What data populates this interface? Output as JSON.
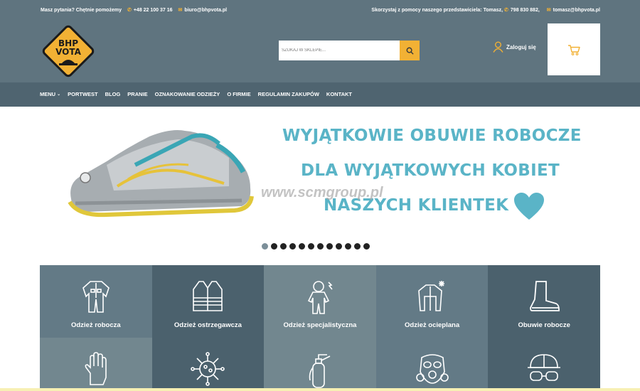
{
  "topbar": {
    "question": "Masz pytania? Chętnie pomożemy",
    "phone": "+48 22 100 37 16",
    "email": "biuro@bhpvota.pl",
    "rep_text": "Skorzystaj z pomocy naszego przedstawiciela: Tomasz,",
    "rep_phone": "798 830 882,",
    "rep_email": "tomasz@bhpvota.pl"
  },
  "logo": {
    "line1": "BHP",
    "line2": "VOTA"
  },
  "search": {
    "placeholder": "SZUKAJ W SKLEPIE..."
  },
  "account": {
    "login_label": "Zaloguj się"
  },
  "nav": {
    "items": [
      "MENU",
      "PORTWEST",
      "BLOG",
      "PRANIE",
      "OZNAKOWANIE ODZIEŻY",
      "O FIRMIE",
      "REGULAMIN ZAKUPÓW",
      "KONTAKT"
    ]
  },
  "hero": {
    "line1": "WYJĄTKOWIE OBUWIE ROBOCZE",
    "line2": "DLA WYJĄTKOWYCH KOBIET",
    "line3": "NASZYCH KLIENTEK",
    "watermark": "www.scmgroup.pl",
    "slide_count": 12,
    "active_slide": 1
  },
  "categories": [
    {
      "label": "Odzież robocza",
      "icon": "coverall-icon"
    },
    {
      "label": "Odzież ostrzegawcza",
      "icon": "hi-vis-vest-icon"
    },
    {
      "label": "Odzież specjalistyczna",
      "icon": "hazmat-suit-icon"
    },
    {
      "label": "Odzież ocieplana",
      "icon": "winter-coat-icon"
    },
    {
      "label": "Obuwie robocze",
      "icon": "work-boot-icon"
    },
    {
      "label": "",
      "icon": "glove-icon"
    },
    {
      "label": "",
      "icon": "virus-icon"
    },
    {
      "label": "",
      "icon": "fire-extinguisher-icon"
    },
    {
      "label": "",
      "icon": "gas-mask-icon"
    },
    {
      "label": "",
      "icon": "helmet-goggles-icon"
    }
  ],
  "colors": {
    "header_bg": "#5f747f",
    "nav_bg": "#4f6470",
    "accent": "#f2b134",
    "hero_text": "#5ab4c7"
  }
}
